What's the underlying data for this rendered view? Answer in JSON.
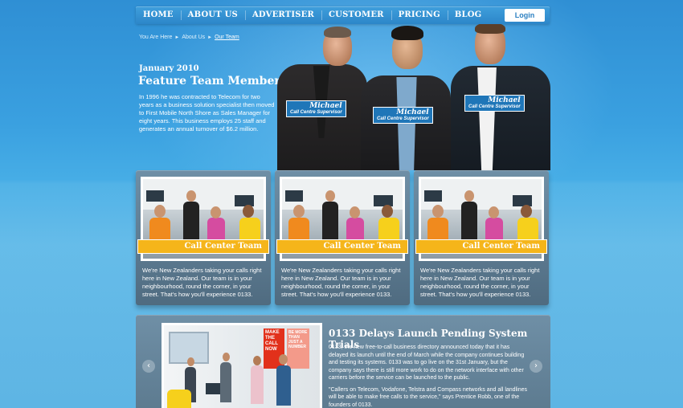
{
  "nav": {
    "items": [
      "HOME",
      "ABOUT US",
      "ADVERTISER",
      "CUSTOMER",
      "PRICING",
      "BLOG"
    ],
    "login_label": "Login"
  },
  "breadcrumb": {
    "items": [
      "You Are Here",
      "About Us",
      "Our Team"
    ]
  },
  "hero": {
    "date": "January 2010",
    "title": "Feature Team Members",
    "body": "In 1996 he was contracted to Telecom for two years as a business solution specialist then moved to First Mobile North Shore as Sales Manager for eight years. This business employs 25 staff and generates an annual turnover of $6.2 million."
  },
  "team": [
    {
      "name": "Michael",
      "role": "Call Centre Supervisor"
    },
    {
      "name": "Michael",
      "role": "Call Centre Supervisor"
    },
    {
      "name": "Michael",
      "role": "Call Centre Supervisor"
    }
  ],
  "cards": [
    {
      "title": "Call Center Team",
      "text": "We're New Zealanders taking your calls right here in New Zealand. Our team is in your neighbourhood, round the corner, in your street. That's how you'll experience 0133."
    },
    {
      "title": "Call Center Team",
      "text": "We're New Zealanders taking your calls right here in New Zealand. Our team is in your neighbourhood, round the corner, in your street. That's how you'll experience 0133."
    },
    {
      "title": "Call Center Team",
      "text": "We're New Zealanders taking your calls right here in New Zealand. Our team is in your neighbourhood, round the corner, in your street. That's how you'll experience 0133."
    }
  ],
  "news": {
    "title": "0133 Delays Launch Pending System Trials",
    "paragraph1": "0133, the new free-to-call business directory announced today that it has delayed its launch until the end of March while the company continues building and testing its systems. 0133 was to go live on the 31st January, but the company says there is still more work to do on the network interface with other carriers before the service can be launched to the public.",
    "paragraph2": "\"Callers on Telecom, Vodafone, Telstra and Compass networks and all landlines will be able to make free calls to the service,\" says Prentice Robb, one of the founders of 0133.",
    "poster_text_1": "MAKE THE CALL NOW",
    "poster_text_2": "BE MORE THAN JUST A NUMBER",
    "prev_icon": "chevron-left-icon",
    "next_icon": "chevron-right-icon"
  },
  "colors": {
    "nav_bg": "#2c86c9",
    "banner": "#f5b51a",
    "tag_bg": "#1f76b8",
    "card_bg": "#5c7a90"
  }
}
